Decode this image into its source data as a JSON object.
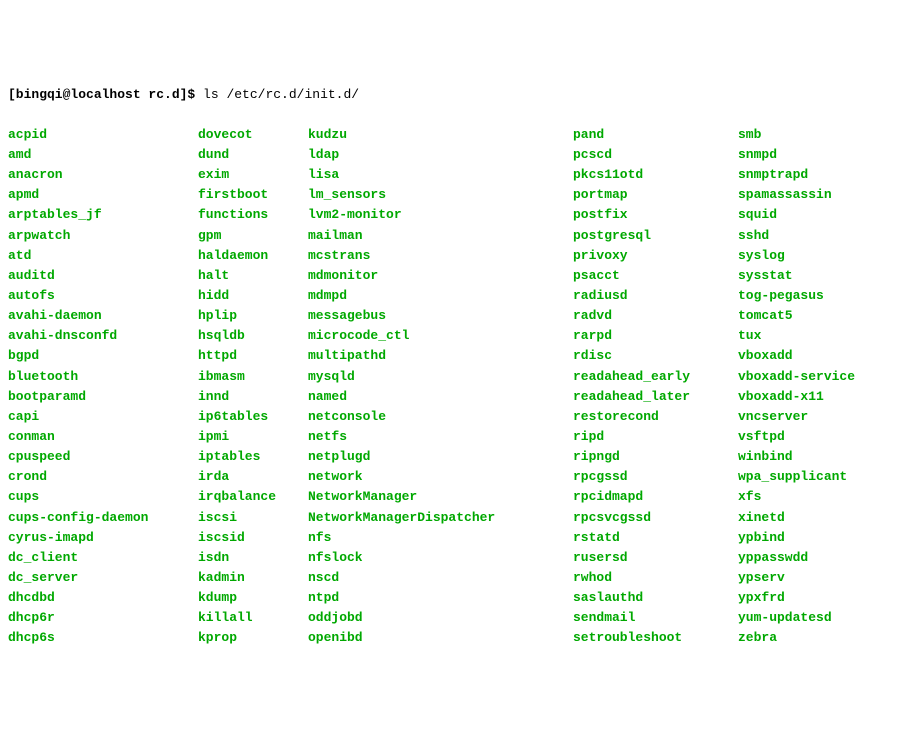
{
  "prompt": "[bingqi@localhost rc.d]$ ",
  "command": "ls /etc/rc.d/init.d/",
  "columns": [
    [
      "acpid",
      "amd",
      "anacron",
      "apmd",
      "arptables_jf",
      "arpwatch",
      "atd",
      "auditd",
      "autofs",
      "avahi-daemon",
      "avahi-dnsconfd",
      "bgpd",
      "bluetooth",
      "bootparamd",
      "capi",
      "conman",
      "cpuspeed",
      "crond",
      "cups",
      "cups-config-daemon",
      "cyrus-imapd",
      "dc_client",
      "dc_server",
      "dhcdbd",
      "dhcp6r",
      "dhcp6s"
    ],
    [
      "dovecot",
      "dund",
      "exim",
      "firstboot",
      "functions",
      "gpm",
      "haldaemon",
      "halt",
      "hidd",
      "hplip",
      "hsqldb",
      "httpd",
      "ibmasm",
      "innd",
      "ip6tables",
      "ipmi",
      "iptables",
      "irda",
      "irqbalance",
      "iscsi",
      "iscsid",
      "isdn",
      "kadmin",
      "kdump",
      "killall",
      "kprop"
    ],
    [
      "kudzu",
      "ldap",
      "lisa",
      "lm_sensors",
      "lvm2-monitor",
      "mailman",
      "mcstrans",
      "mdmonitor",
      "mdmpd",
      "messagebus",
      "microcode_ctl",
      "multipathd",
      "mysqld",
      "named",
      "netconsole",
      "netfs",
      "netplugd",
      "network",
      "NetworkManager",
      "NetworkManagerDispatcher",
      "nfs",
      "nfslock",
      "nscd",
      "ntpd",
      "oddjobd",
      "openibd"
    ],
    [
      "pand",
      "pcscd",
      "pkcs11otd",
      "portmap",
      "postfix",
      "postgresql",
      "privoxy",
      "psacct",
      "radiusd",
      "radvd",
      "rarpd",
      "rdisc",
      "readahead_early",
      "readahead_later",
      "restorecond",
      "ripd",
      "ripngd",
      "rpcgssd",
      "rpcidmapd",
      "rpcsvcgssd",
      "rstatd",
      "rusersd",
      "rwhod",
      "saslauthd",
      "sendmail",
      "setroubleshoot"
    ],
    [
      "smb",
      "snmpd",
      "snmptrapd",
      "spamassassin",
      "squid",
      "sshd",
      "syslog",
      "sysstat",
      "tog-pegasus",
      "tomcat5",
      "tux",
      "vboxadd",
      "vboxadd-service",
      "vboxadd-x11",
      "vncserver",
      "vsftpd",
      "winbind",
      "wpa_supplicant",
      "xfs",
      "xinetd",
      "ypbind",
      "yppasswdd",
      "ypserv",
      "ypxfrd",
      "yum-updatesd",
      "zebra"
    ]
  ]
}
